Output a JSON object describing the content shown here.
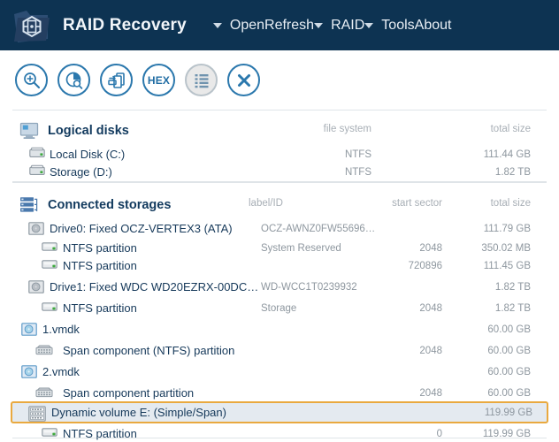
{
  "window": {
    "app_title": "RAID Recovery",
    "logo_icon": "raid-folder-logo-icon"
  },
  "menu": {
    "items": [
      {
        "label": "Open",
        "has_caret": true,
        "icon": "chevron-down-icon"
      },
      {
        "label": "Refresh",
        "has_caret": false,
        "icon": ""
      },
      {
        "label": "RAID",
        "has_caret": true,
        "icon": "chevron-down-icon"
      },
      {
        "label": "Tools",
        "has_caret": true,
        "icon": "chevron-down-icon"
      },
      {
        "label": "About",
        "has_caret": false,
        "icon": ""
      }
    ]
  },
  "toolbar": {
    "buttons": [
      {
        "name": "search-disk-button",
        "icon": "magnifier-icon",
        "label": "",
        "active": false
      },
      {
        "name": "disk-scan-button",
        "icon": "disk-search-icon",
        "label": "",
        "active": false
      },
      {
        "name": "open-image-button",
        "icon": "import-file-icon",
        "label": "",
        "active": false
      },
      {
        "name": "hex-viewer-button",
        "icon": "hex-icon",
        "label": "HEX",
        "active": false
      },
      {
        "name": "list-view-button",
        "icon": "list-icon",
        "label": "",
        "active": true
      },
      {
        "name": "close-button",
        "icon": "close-x-icon",
        "label": "",
        "active": false
      }
    ]
  },
  "logical_disks": {
    "title": "Logical disks",
    "icon": "monitor-icon",
    "columns": [
      {
        "key": "file_system",
        "label": "file system"
      },
      {
        "key": "total_size",
        "label": "total size"
      }
    ],
    "rows": [
      {
        "icon": "disk-volume-icon",
        "name": "Local Disk (C:)",
        "file_system": "NTFS",
        "total_size": "111.44 GB"
      },
      {
        "icon": "disk-volume-icon",
        "name": "Storage (D:)",
        "file_system": "NTFS",
        "total_size": "1.82 TB"
      }
    ]
  },
  "connected_storages": {
    "title": "Connected storages",
    "icon": "stacked-servers-icon",
    "columns": [
      {
        "key": "label_id",
        "label": "label/ID"
      },
      {
        "key": "start_sector",
        "label": "start sector"
      },
      {
        "key": "total_size",
        "label": "total size"
      }
    ],
    "rows": [
      {
        "icon": "physical-drive-icon",
        "indent": 0,
        "name": "Drive0: Fixed OCZ-VERTEX3 (ATA)",
        "label_id": "OCZ-AWNZ0FW55696…",
        "start_sector": "",
        "total_size": "111.79 GB",
        "selected": false
      },
      {
        "icon": "partition-icon",
        "indent": 1,
        "name": "NTFS partition",
        "label_id": "System Reserved",
        "start_sector": "2048",
        "total_size": "350.02 MB",
        "selected": false
      },
      {
        "icon": "partition-icon",
        "indent": 1,
        "name": "NTFS partition",
        "label_id": "",
        "start_sector": "720896",
        "total_size": "111.45 GB",
        "selected": false
      },
      {
        "icon": "physical-drive-icon",
        "indent": 0,
        "name": "Drive1: Fixed WDC WD20EZRX-00DC…",
        "label_id": "WD-WCC1T0239932",
        "start_sector": "",
        "total_size": "1.82 TB",
        "selected": false
      },
      {
        "icon": "partition-icon",
        "indent": 1,
        "name": "NTFS partition",
        "label_id": "Storage",
        "start_sector": "2048",
        "total_size": "1.82 TB",
        "selected": false
      },
      {
        "icon": "vmdk-icon",
        "indent": 0,
        "name": "1.vmdk",
        "label_id": "",
        "start_sector": "",
        "total_size": "60.00 GB",
        "selected": false
      },
      {
        "icon": "span-component-icon",
        "indent": 1,
        "name": "Span component (NTFS) partition",
        "label_id": "",
        "start_sector": "2048",
        "total_size": "60.00 GB",
        "selected": false
      },
      {
        "icon": "vmdk-icon",
        "indent": 0,
        "name": "2.vmdk",
        "label_id": "",
        "start_sector": "",
        "total_size": "60.00 GB",
        "selected": false
      },
      {
        "icon": "span-component-icon",
        "indent": 1,
        "name": "Span component partition",
        "label_id": "",
        "start_sector": "2048",
        "total_size": "60.00 GB",
        "selected": false
      },
      {
        "icon": "dynamic-volume-icon",
        "indent": 0,
        "name": "Dynamic volume E: (Simple/Span)",
        "label_id": "",
        "start_sector": "",
        "total_size": "119.99 GB",
        "selected": true
      },
      {
        "icon": "partition-icon",
        "indent": 1,
        "name": "NTFS partition",
        "label_id": "",
        "start_sector": "0",
        "total_size": "119.99 GB",
        "selected": false
      }
    ]
  },
  "colors": {
    "titlebar_bg": "#0d3352",
    "accent_blue": "#2b78ad",
    "heading_text": "#123a5e",
    "row_text": "#16395a",
    "muted_text": "#8e979f",
    "selection_border": "#e9a93f",
    "selection_fill": "#e4eaf0",
    "led_green": "#3faa3f"
  }
}
